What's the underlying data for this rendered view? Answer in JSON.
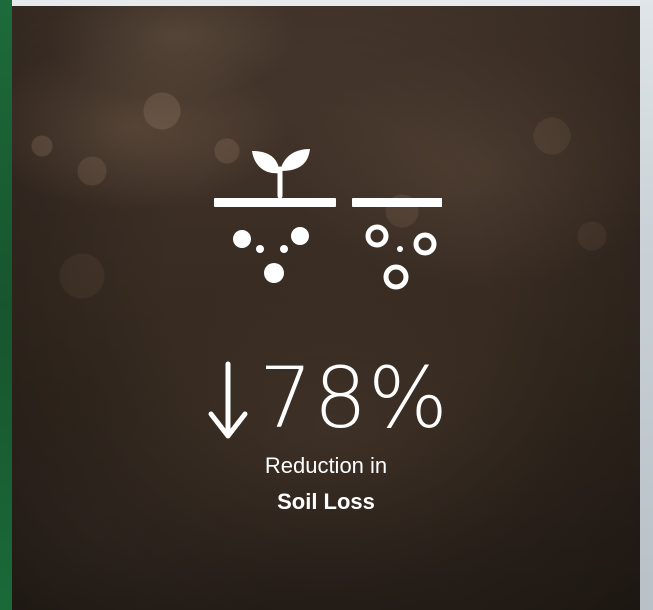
{
  "stat": {
    "arrow_icon": "arrow-down-icon",
    "value": "78%",
    "caption_line1": "Reduction in",
    "caption_line2": "Soil Loss"
  },
  "icon": {
    "name": "soil-seedling-icon"
  },
  "colors": {
    "text": "#ffffff",
    "left_accent": "#1d6b3a",
    "soil_dark": "#2c231c"
  }
}
